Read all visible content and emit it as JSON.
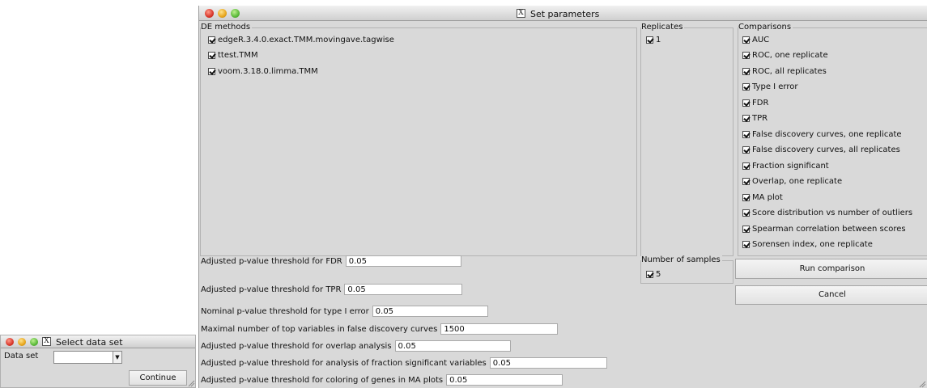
{
  "main_window": {
    "title": "Set parameters",
    "de_methods": {
      "legend": "DE methods",
      "items": [
        "edgeR.3.4.0.exact.TMM.movingave.tagwise",
        "ttest.TMM",
        "voom.3.18.0.limma.TMM"
      ]
    },
    "replicates": {
      "legend": "Replicates",
      "items": [
        "1"
      ]
    },
    "comparisons": {
      "legend": "Comparisons",
      "items": [
        "AUC",
        "ROC, one replicate",
        "ROC, all replicates",
        "Type I error",
        "FDR",
        "TPR",
        "False discovery curves, one replicate",
        "False discovery curves, all replicates",
        "Fraction significant",
        "Overlap, one replicate",
        "MA plot",
        "Score distribution vs number of outliers",
        "Spearman correlation between scores",
        "Sorensen index, one replicate"
      ]
    },
    "number_of_samples": {
      "legend": "Number of samples",
      "items": [
        "5"
      ]
    },
    "params": [
      {
        "label": "Adjusted p-value threshold for FDR",
        "value": "0.05"
      },
      {
        "label": "Adjusted p-value threshold for TPR",
        "value": "0.05"
      },
      {
        "label": "Nominal p-value threshold for type I error",
        "value": "0.05"
      },
      {
        "label": "Maximal number of top variables in false discovery curves",
        "value": "1500"
      },
      {
        "label": "Adjusted p-value threshold for overlap analysis",
        "value": "0.05"
      },
      {
        "label": "Adjusted p-value threshold for analysis of fraction significant variables",
        "value": "0.05"
      },
      {
        "label": "Adjusted p-value threshold for coloring of genes in MA plots",
        "value": "0.05"
      }
    ],
    "buttons": {
      "run": "Run comparison",
      "cancel": "Cancel"
    }
  },
  "select_window": {
    "title": "Select data set",
    "data_set_label": "Data set",
    "data_set_value": "",
    "continue_label": "Continue"
  },
  "icons": {
    "close": "close-traffic-light",
    "minimize": "minimize-traffic-light",
    "zoom": "zoom-traffic-light",
    "app": "x11-icon"
  }
}
